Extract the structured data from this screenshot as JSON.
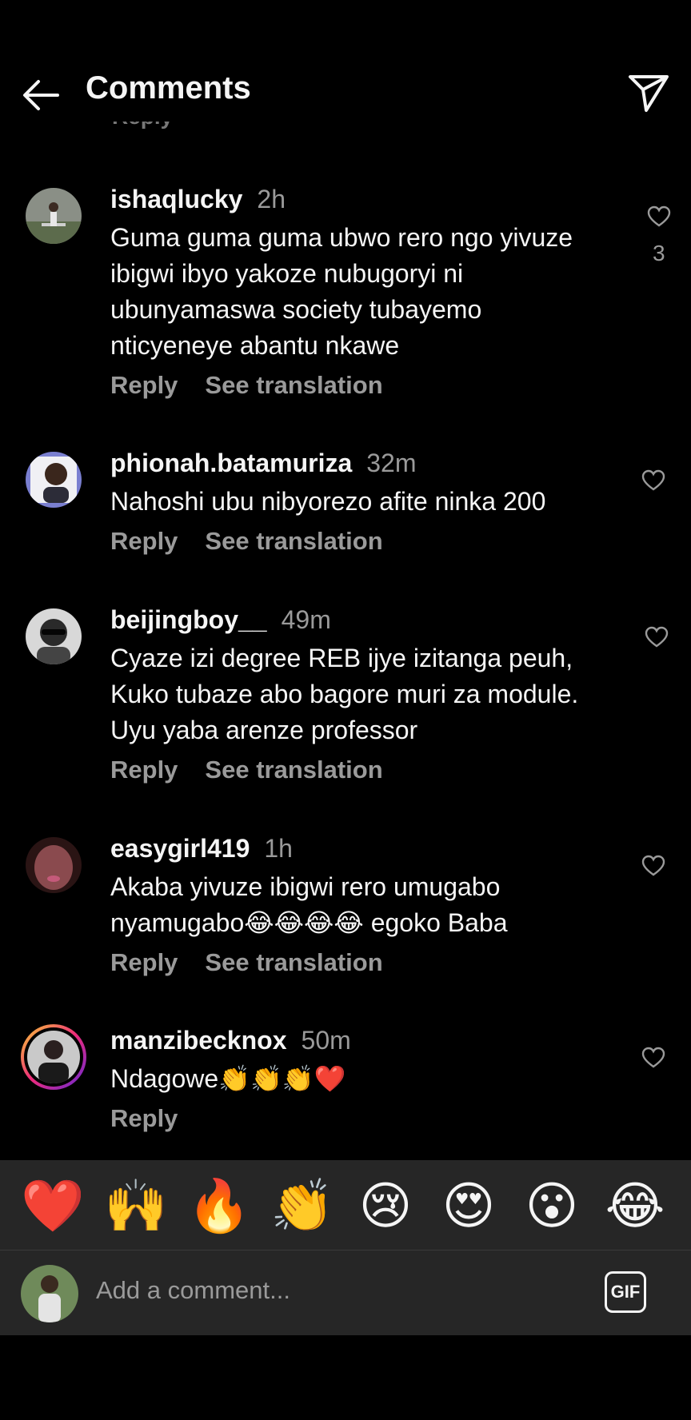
{
  "header": {
    "title": "Comments",
    "ghost_text": "Reply"
  },
  "comments": [
    {
      "username": "ishaqlucky",
      "time": "2h",
      "text": "Guma guma guma ubwo rero ngo yivuze ibigwi ibyo yakoze nubugoryi ni ubunyamaswa society tubayemo nticyeneye abantu nkawe",
      "likes": "3",
      "reply": "Reply",
      "translate": "See translation"
    },
    {
      "username": "phionah.batamuriza",
      "time": "32m",
      "text": "Nahoshi ubu nibyorezo  afite ninka 200",
      "reply": "Reply",
      "translate": "See translation"
    },
    {
      "username": "beijingboy__",
      "time": "49m",
      "text": "Cyaze izi degree REB ijye izitanga peuh, Kuko tubaze abo bagore muri za module. Uyu yaba arenze professor",
      "reply": "Reply",
      "translate": "See translation"
    },
    {
      "username": "easygirl419",
      "time": "1h",
      "text": "Akaba yivuze ibigwi rero umugabo nyamugabo😂😂😂😂 egoko Baba",
      "reply": "Reply",
      "translate": "See translation"
    },
    {
      "username": "manzibecknox",
      "time": "50m",
      "text": "Ndagowe👏👏👏❤️",
      "reply": "Reply"
    }
  ],
  "emoji_bar": [
    "❤️",
    "🙌",
    "🔥",
    "👏",
    "😢",
    "😍",
    "😮",
    "😂"
  ],
  "composer": {
    "placeholder": "Add a comment...",
    "gif_label": "GIF"
  },
  "colors": {
    "background": "#000000",
    "panel": "#262626",
    "muted": "#9a9a9a"
  }
}
